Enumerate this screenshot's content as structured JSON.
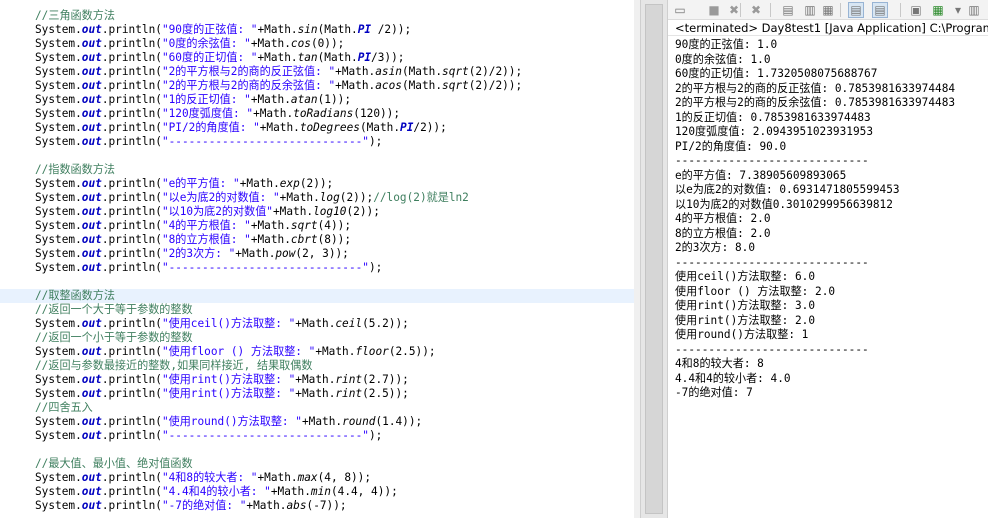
{
  "editor": {
    "lines": [
      {
        "type": "comment",
        "text": "//三角函数方法"
      },
      {
        "type": "println",
        "str": "\"90度的正弦值: \"",
        "parts": [
          {
            "t": "+Math."
          },
          {
            "m": "sin"
          },
          {
            "t": "(Math."
          },
          {
            "f": "PI"
          },
          {
            "t": " /2));"
          }
        ]
      },
      {
        "type": "println",
        "str": "\"0度的余弦值: \"",
        "parts": [
          {
            "t": "+Math."
          },
          {
            "m": "cos"
          },
          {
            "t": "(0));"
          }
        ]
      },
      {
        "type": "println",
        "str": "\"60度的正切值: \"",
        "parts": [
          {
            "t": "+Math."
          },
          {
            "m": "tan"
          },
          {
            "t": "(Math."
          },
          {
            "f": "PI"
          },
          {
            "t": "/3));"
          }
        ]
      },
      {
        "type": "println",
        "str": "\"2的平方根与2的商的反正弦值: \"",
        "parts": [
          {
            "t": "+Math."
          },
          {
            "m": "asin"
          },
          {
            "t": "(Math."
          },
          {
            "m": "sqrt"
          },
          {
            "t": "(2)/2));"
          }
        ]
      },
      {
        "type": "println",
        "str": "\"2的平方根与2的商的反余弦值: \"",
        "parts": [
          {
            "t": "+Math."
          },
          {
            "m": "acos"
          },
          {
            "t": "(Math."
          },
          {
            "m": "sqrt"
          },
          {
            "t": "(2)/2));"
          }
        ]
      },
      {
        "type": "println",
        "str": "\"1的反正切值: \"",
        "parts": [
          {
            "t": "+Math."
          },
          {
            "m": "atan"
          },
          {
            "t": "(1));"
          }
        ]
      },
      {
        "type": "println",
        "str": "\"120度弧度值: \"",
        "parts": [
          {
            "t": "+Math."
          },
          {
            "m": "toRadians"
          },
          {
            "t": "(120));"
          }
        ]
      },
      {
        "type": "println",
        "str": "\"PI/2的角度值: \"",
        "parts": [
          {
            "t": "+Math."
          },
          {
            "m": "toDegrees"
          },
          {
            "t": "(Math."
          },
          {
            "f": "PI"
          },
          {
            "t": "/2));"
          }
        ]
      },
      {
        "type": "println",
        "str": "\"-----------------------------\"",
        "parts": [
          {
            "t": ");"
          }
        ]
      },
      {
        "type": "blank"
      },
      {
        "type": "comment",
        "text": "//指数函数方法"
      },
      {
        "type": "println",
        "str": "\"e的平方值: \"",
        "parts": [
          {
            "t": "+Math."
          },
          {
            "m": "exp"
          },
          {
            "t": "(2));"
          }
        ]
      },
      {
        "type": "println",
        "str": "\"以e为底2的对数值: \"",
        "parts": [
          {
            "t": "+Math."
          },
          {
            "m": "log"
          },
          {
            "t": "(2));"
          },
          {
            "c": "//log(2)就是ln2"
          }
        ]
      },
      {
        "type": "println",
        "str": "\"以10为底2的对数值\"",
        "parts": [
          {
            "t": "+Math."
          },
          {
            "m": "log10"
          },
          {
            "t": "(2));"
          }
        ]
      },
      {
        "type": "println",
        "str": "\"4的平方根值: \"",
        "parts": [
          {
            "t": "+Math."
          },
          {
            "m": "sqrt"
          },
          {
            "t": "(4));"
          }
        ]
      },
      {
        "type": "println",
        "str": "\"8的立方根值: \"",
        "parts": [
          {
            "t": "+Math."
          },
          {
            "m": "cbrt"
          },
          {
            "t": "(8));"
          }
        ]
      },
      {
        "type": "println",
        "str": "\"2的3次方: \"",
        "parts": [
          {
            "t": "+Math."
          },
          {
            "m": "pow"
          },
          {
            "t": "(2, 3));"
          }
        ]
      },
      {
        "type": "println",
        "str": "\"-----------------------------\"",
        "parts": [
          {
            "t": ");"
          }
        ]
      },
      {
        "type": "blank"
      },
      {
        "type": "comment",
        "text": "//取整函数方法",
        "highlight": true
      },
      {
        "type": "comment",
        "text": "//返回一个大于等于参数的整数"
      },
      {
        "type": "println",
        "str": "\"使用ceil()方法取整: \"",
        "parts": [
          {
            "t": "+Math."
          },
          {
            "m": "ceil"
          },
          {
            "t": "(5.2));"
          }
        ]
      },
      {
        "type": "comment",
        "text": "//返回一个小于等于参数的整数"
      },
      {
        "type": "println",
        "str": "\"使用floor () 方法取整: \"",
        "parts": [
          {
            "t": "+Math."
          },
          {
            "m": "floor"
          },
          {
            "t": "(2.5));"
          }
        ]
      },
      {
        "type": "comment",
        "text": "//返回与参数最接近的整数,如果同样接近, 结果取偶数"
      },
      {
        "type": "println",
        "str": "\"使用rint()方法取整: \"",
        "parts": [
          {
            "t": "+Math."
          },
          {
            "m": "rint"
          },
          {
            "t": "(2.7));"
          }
        ]
      },
      {
        "type": "println",
        "str": "\"使用rint()方法取整: \"",
        "parts": [
          {
            "t": "+Math."
          },
          {
            "m": "rint"
          },
          {
            "t": "(2.5));"
          }
        ]
      },
      {
        "type": "comment",
        "text": "//四舍五入"
      },
      {
        "type": "println",
        "str": "\"使用round()方法取整: \"",
        "parts": [
          {
            "t": "+Math."
          },
          {
            "m": "round"
          },
          {
            "t": "(1.4));"
          }
        ]
      },
      {
        "type": "println",
        "str": "\"-----------------------------\"",
        "parts": [
          {
            "t": ");"
          }
        ]
      },
      {
        "type": "blank"
      },
      {
        "type": "comment",
        "text": "//最大值、最小值、绝对值函数"
      },
      {
        "type": "println",
        "str": "\"4和8的较大者: \"",
        "parts": [
          {
            "t": "+Math."
          },
          {
            "m": "max"
          },
          {
            "t": "(4, 8));"
          }
        ]
      },
      {
        "type": "println",
        "str": "\"4.4和4的较小者: \"",
        "parts": [
          {
            "t": "+Math."
          },
          {
            "m": "min"
          },
          {
            "t": "(4.4, 4));"
          }
        ]
      },
      {
        "type": "println",
        "str": "\"-7的绝对值: \"",
        "parts": [
          {
            "t": "+Math."
          },
          {
            "m": "abs"
          },
          {
            "t": "(-7));"
          }
        ]
      }
    ]
  },
  "console": {
    "status": "<terminated> Day8test1 [Java Application] C:\\Program",
    "toolbar_icons": [
      "console-icon",
      "terminate-icon",
      "remove-launch-icon",
      "remove-all-icon",
      "clear-console-icon",
      "scroll-lock-icon",
      "word-wrap-icon",
      "show-on-output-icon",
      "show-on-error-icon",
      "pin-console-icon",
      "display-console-icon",
      "display-dropdown-icon",
      "open-console-icon"
    ],
    "output": [
      "90度的正弦值: 1.0",
      "0度的余弦值: 1.0",
      "60度的正切值: 1.7320508075688767",
      "2的平方根与2的商的反正弦值: 0.7853981633974484",
      "2的平方根与2的商的反余弦值: 0.7853981633974483",
      "1的反正切值: 0.7853981633974483",
      "120度弧度值: 2.0943951023931953",
      "PI/2的角度值: 90.0",
      "-----------------------------",
      "e的平方值: 7.38905609893065",
      "以e为底2的对数值: 0.6931471805599453",
      "以10为底2的对数值0.3010299956639812",
      "4的平方根值: 2.0",
      "8的立方根值: 2.0",
      "2的3次方: 8.0",
      "-----------------------------",
      "使用ceil()方法取整: 6.0",
      "使用floor () 方法取整: 2.0",
      "使用rint()方法取整: 3.0",
      "使用rint()方法取整: 2.0",
      "使用round()方法取整: 1",
      "-----------------------------",
      "4和8的较大者: 8",
      "4.4和4的较小者: 4.0",
      "-7的绝对值: 7"
    ]
  }
}
